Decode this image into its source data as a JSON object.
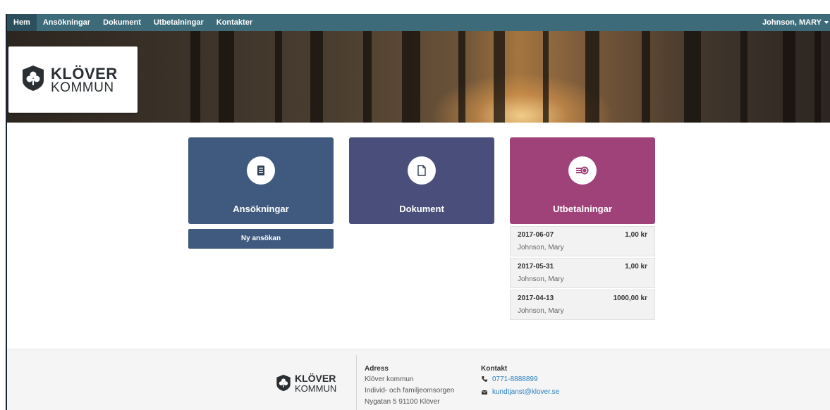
{
  "nav": {
    "items": [
      {
        "label": "Hem",
        "active": true
      },
      {
        "label": "Ansökningar",
        "active": false
      },
      {
        "label": "Dokument",
        "active": false
      },
      {
        "label": "Utbetalningar",
        "active": false
      },
      {
        "label": "Kontakter",
        "active": false
      }
    ],
    "user": "Johnson, MARY"
  },
  "brand": {
    "line1": "KLÖVER",
    "line2": "KOMMUN"
  },
  "tiles": [
    {
      "label": "Ansökningar",
      "icon": "application-form-icon",
      "color": "#3f5a7e"
    },
    {
      "label": "Dokument",
      "icon": "document-icon",
      "color": "#494f7a"
    },
    {
      "label": "Utbetalningar",
      "icon": "coins-icon",
      "color": "#a0427a"
    }
  ],
  "new_application_label": "Ny ansökan",
  "payments": [
    {
      "date": "2017-06-07",
      "amount": "1,00 kr",
      "name": "Johnson, Mary"
    },
    {
      "date": "2017-05-31",
      "amount": "1,00 kr",
      "name": "Johnson, Mary"
    },
    {
      "date": "2017-04-13",
      "amount": "1000,00 kr",
      "name": "Johnson, Mary"
    }
  ],
  "footer": {
    "address": {
      "heading": "Adress",
      "lines": [
        "Klöver kommun",
        "Individ- och familjeomsorgen",
        "Nygatan 5 91100 Klöver"
      ]
    },
    "contact": {
      "heading": "Kontakt",
      "phone": "0771-8888899",
      "email": "kundtjanst@klover.se"
    }
  }
}
